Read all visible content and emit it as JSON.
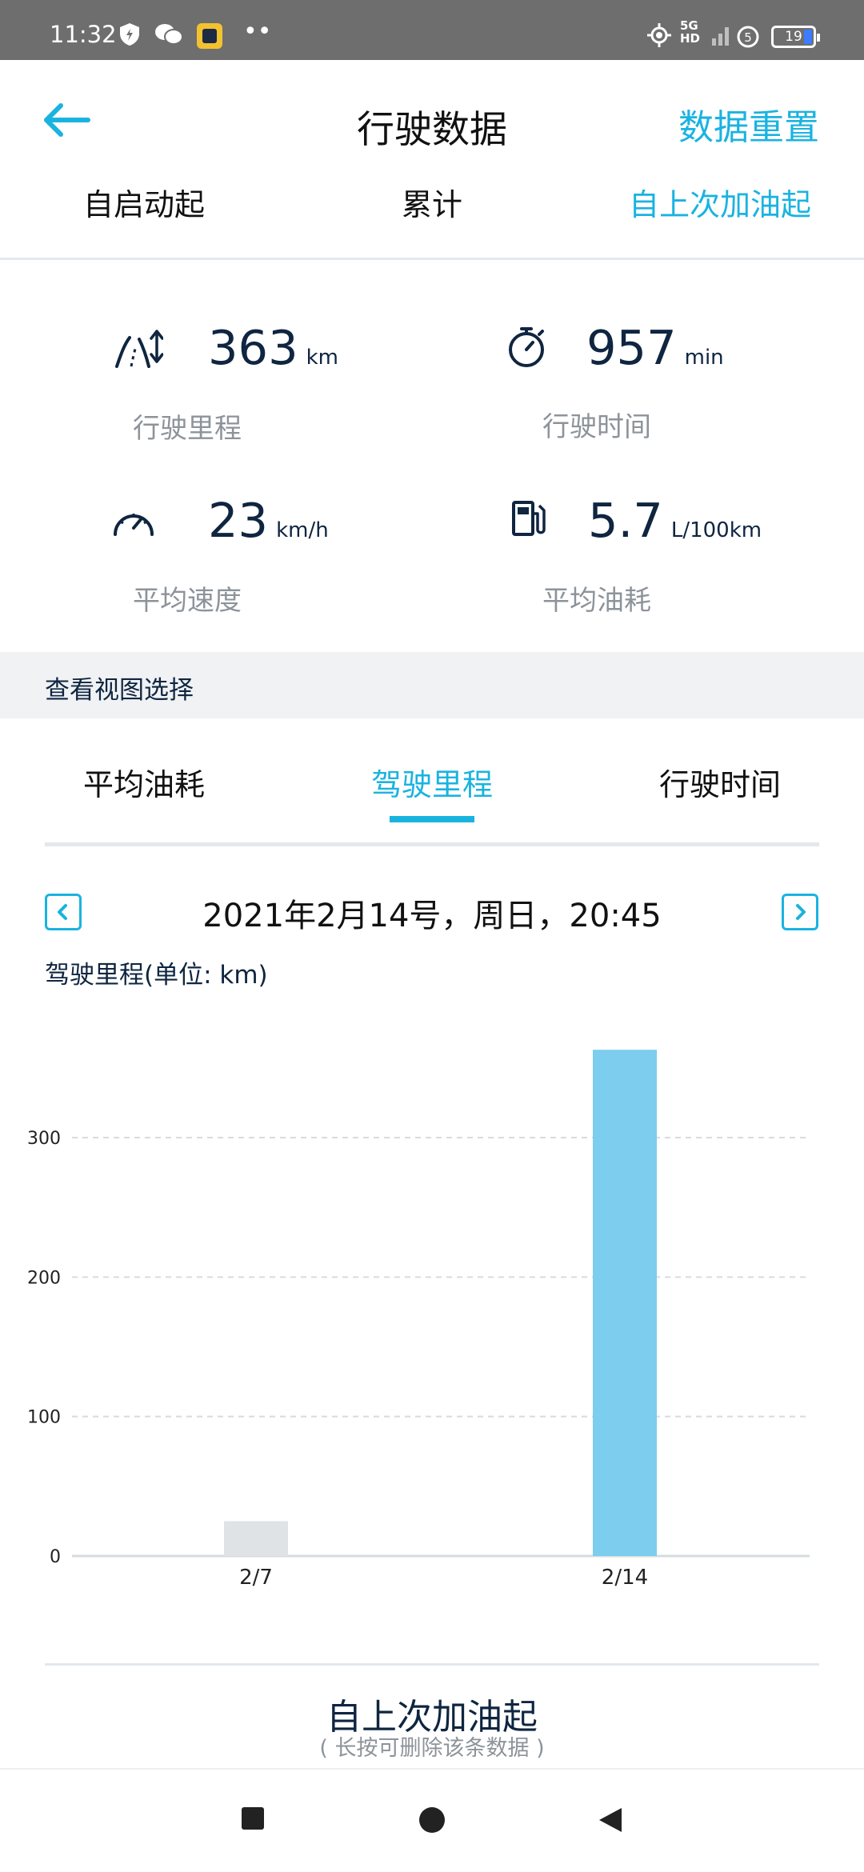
{
  "status_bar": {
    "time": "11:32",
    "network": "5G HD",
    "battery_level": "19"
  },
  "header": {
    "title": "行驶数据",
    "reset_label": "数据重置",
    "back_icon": "arrow-left-icon",
    "tabs": [
      {
        "label": "自启动起",
        "active": false
      },
      {
        "label": "累计",
        "active": false
      },
      {
        "label": "自上次加油起",
        "active": true
      }
    ]
  },
  "stats": [
    {
      "icon": "route-icon",
      "value": "363",
      "unit": "km",
      "label": "行驶里程"
    },
    {
      "icon": "stopwatch-icon",
      "value": "957",
      "unit": "min",
      "label": "行驶时间"
    },
    {
      "icon": "speedometer-icon",
      "value": "23",
      "unit": "km/h",
      "label": "平均速度"
    },
    {
      "icon": "fuel-pump-icon",
      "value": "5.7",
      "unit": "L/100km",
      "label": "平均油耗"
    }
  ],
  "view_section": {
    "title": "查看视图选择",
    "tabs": [
      {
        "label": "平均油耗",
        "active": false
      },
      {
        "label": "驾驶里程",
        "active": true
      },
      {
        "label": "行驶时间",
        "active": false
      }
    ]
  },
  "date_nav": {
    "label": "2021年2月14号，周日，20:45",
    "prev_icon": "chevron-left-icon",
    "next_icon": "chevron-right-icon"
  },
  "chart_caption": "驾驶里程(单位: km)",
  "chart_data": {
    "type": "bar",
    "categories": [
      "2/7",
      "2/14"
    ],
    "values": [
      25,
      363
    ],
    "ylim": [
      0,
      370
    ],
    "yticks": [
      0,
      100,
      200,
      300
    ],
    "grid": true,
    "xlabel": "",
    "ylabel": "",
    "colors": {
      "inactive": "#dfe3e6",
      "active": "#7ccdee",
      "grid": "#d6dbdf"
    }
  },
  "footer": {
    "title": "自上次加油起",
    "subtitle": "( 长按可删除该条数据 )"
  },
  "colors": {
    "accent": "#1ab3e0",
    "dark_text": "#0f2540",
    "muted_text": "#8d939a"
  }
}
